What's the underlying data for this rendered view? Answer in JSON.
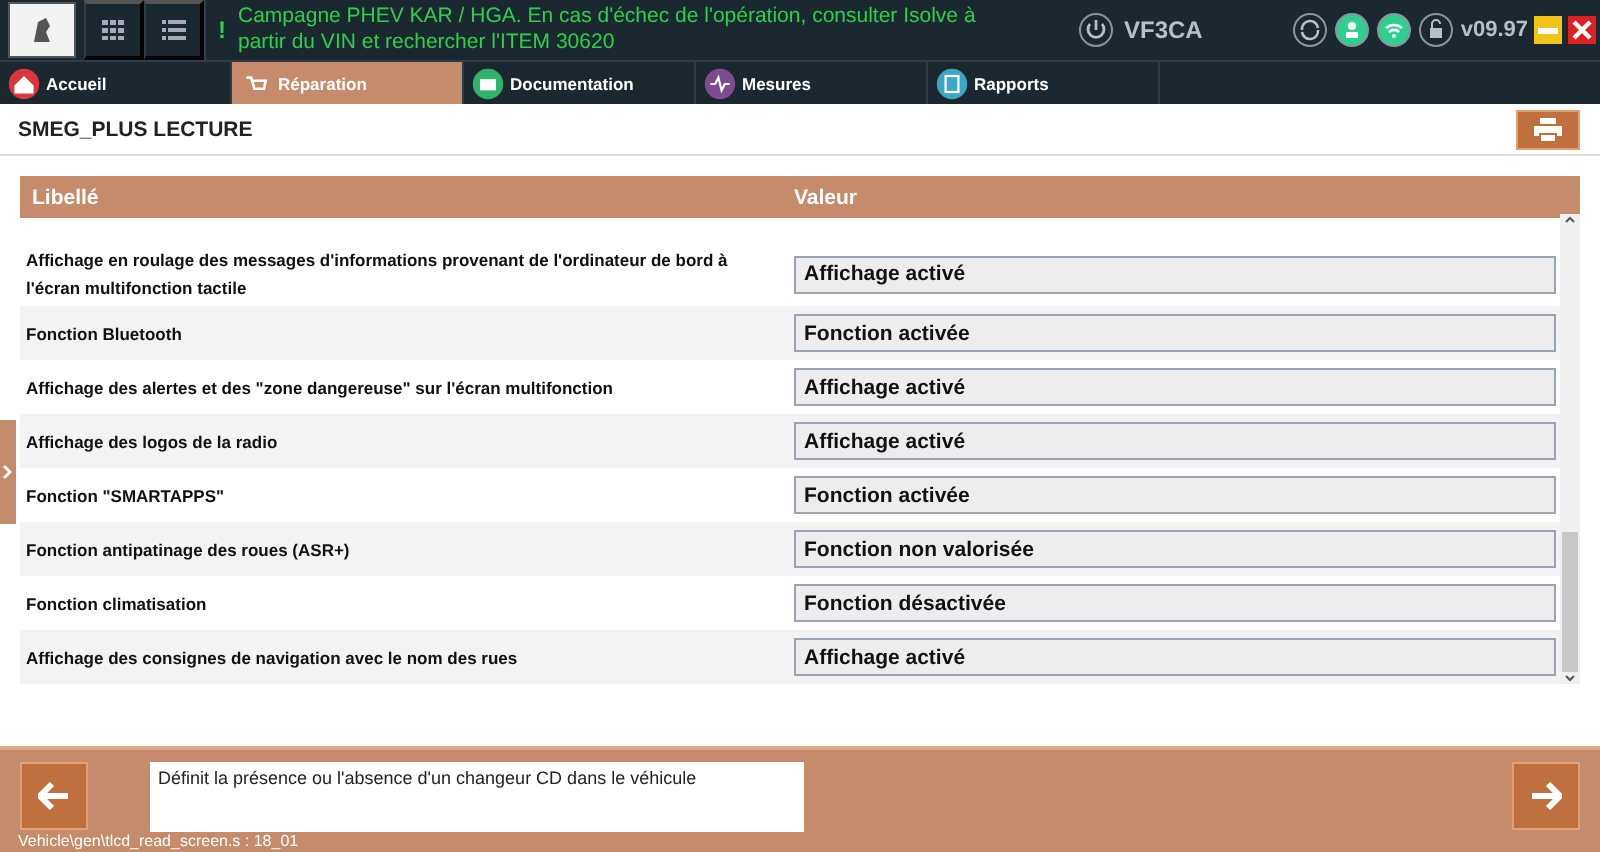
{
  "top_bar": {
    "alert_mark": "!",
    "alert": "Campagne PHEV KAR / HGA. En cas d'échec de l'opération, consulter Isolve à partir du VIN et rechercher l'ITEM 30620",
    "vin": "VF3CA",
    "version": "v09.97"
  },
  "tabs": [
    {
      "label": "Accueil",
      "selected": false,
      "kind": "home"
    },
    {
      "label": "Réparation",
      "selected": true,
      "kind": "cart"
    },
    {
      "label": "Documentation",
      "selected": false,
      "kind": "folder"
    },
    {
      "label": "Mesures",
      "selected": false,
      "kind": "wave"
    },
    {
      "label": "Rapports",
      "selected": false,
      "kind": "report"
    }
  ],
  "page_title": "SMEG_PLUS LECTURE",
  "table": {
    "columns": [
      "Libellé",
      "Valeur"
    ],
    "rows": [
      {
        "label": "Affichage en roulage des messages d'informations provenant de l'ordinateur de bord à l'écran multifonction tactile",
        "value": "Affichage activé"
      },
      {
        "label": "Fonction Bluetooth",
        "value": "Fonction activée"
      },
      {
        "label": "Affichage des alertes et des \"zone dangereuse\" sur l'écran multifonction",
        "value": "Affichage activé"
      },
      {
        "label": "Affichage des logos de la radio",
        "value": "Affichage activé"
      },
      {
        "label": "Fonction \"SMARTAPPS\"",
        "value": "Fonction activée"
      },
      {
        "label": "Fonction antipatinage des roues (ASR+)",
        "value": "Fonction non valorisée"
      },
      {
        "label": "Fonction climatisation",
        "value": "Fonction désactivée"
      },
      {
        "label": "Affichage des consignes de navigation avec le nom des rues",
        "value": "Affichage activé"
      }
    ]
  },
  "description": "Définit la présence ou l'absence d'un changeur CD dans le véhicule",
  "status_path": "Vehicle\\gen\\tlcd_read_screen.s : 18_01"
}
